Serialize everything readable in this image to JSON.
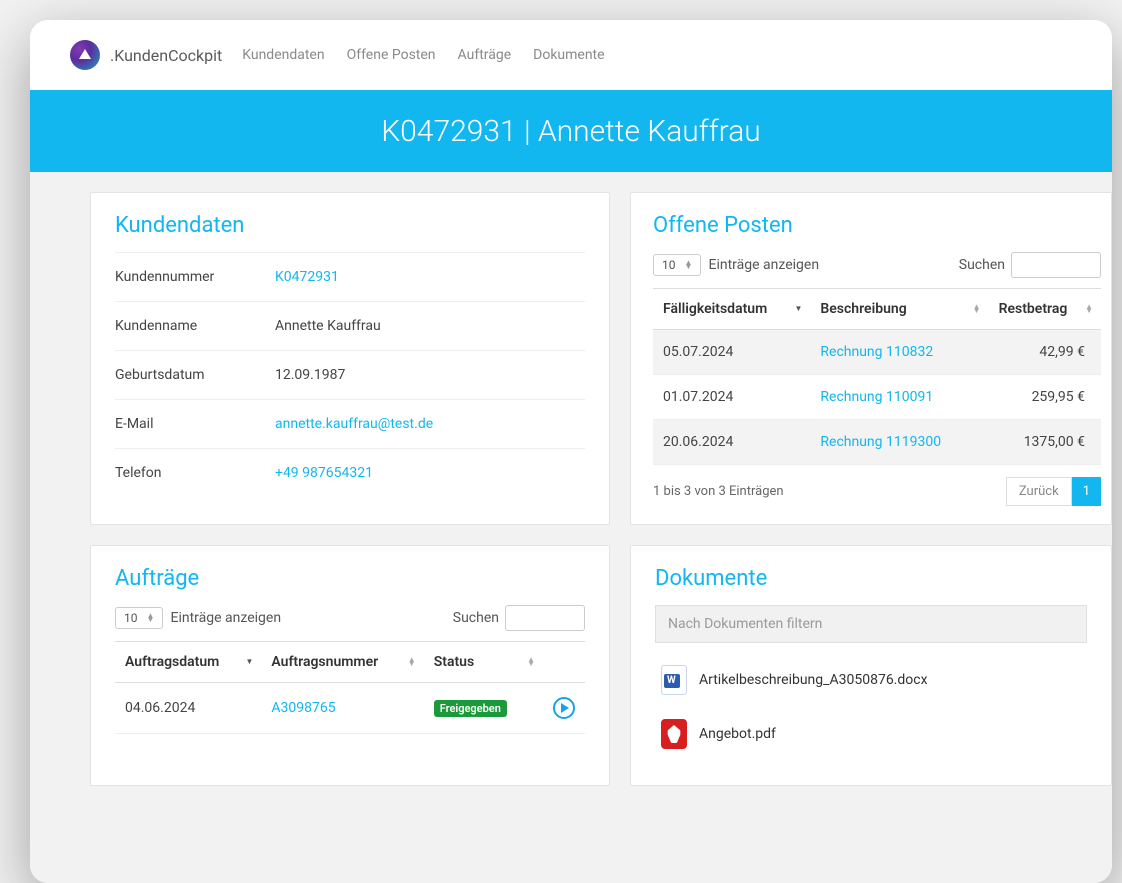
{
  "brand": {
    "text": ".KundenCockpit"
  },
  "nav": {
    "items": [
      "Kundendaten",
      "Offene Posten",
      "Aufträge",
      "Dokumente"
    ]
  },
  "banner": {
    "text": "K0472931 | Annette Kauffrau"
  },
  "kundendaten": {
    "title": "Kundendaten",
    "rows": [
      {
        "label": "Kundennummer",
        "value": "K0472931",
        "link": true
      },
      {
        "label": "Kundenname",
        "value": "Annette Kauffrau",
        "link": false
      },
      {
        "label": "Geburtsdatum",
        "value": "12.09.1987",
        "link": false
      },
      {
        "label": "E-Mail",
        "value": "annette.kauffrau@test.de",
        "link": true
      },
      {
        "label": "Telefon",
        "value": "+49 987654321",
        "link": true
      }
    ]
  },
  "offene": {
    "title": "Offene Posten",
    "page_size": "10",
    "entries_label": "Einträge anzeigen",
    "search_label": "Suchen",
    "cols": [
      "Fälligkeitsdatum",
      "Beschreibung",
      "Restbetrag"
    ],
    "rows": [
      {
        "datum": "05.07.2024",
        "besch": "Rechnung 110832",
        "betrag": "42,99 €"
      },
      {
        "datum": "01.07.2024",
        "besch": "Rechnung 110091",
        "betrag": "259,95 €"
      },
      {
        "datum": "20.06.2024",
        "besch": "Rechnung 1119300",
        "betrag": "1375,00 €"
      }
    ],
    "info": "1 bis 3 von 3 Einträgen",
    "prev": "Zurück",
    "page": "1"
  },
  "auftraege": {
    "title": "Aufträge",
    "page_size": "10",
    "entries_label": "Einträge anzeigen",
    "search_label": "Suchen",
    "cols": [
      "Auftragsdatum",
      "Auftragsnummer",
      "Status",
      ""
    ],
    "rows": [
      {
        "datum": "04.06.2024",
        "nummer": "A3098765",
        "status": "Freigegeben"
      }
    ]
  },
  "dokumente": {
    "title": "Dokumente",
    "filter_placeholder": "Nach Dokumenten filtern",
    "items": [
      {
        "name": "Artikelbeschreibung_A3050876.docx",
        "type": "word"
      },
      {
        "name": "Angebot.pdf",
        "type": "pdf"
      }
    ]
  }
}
